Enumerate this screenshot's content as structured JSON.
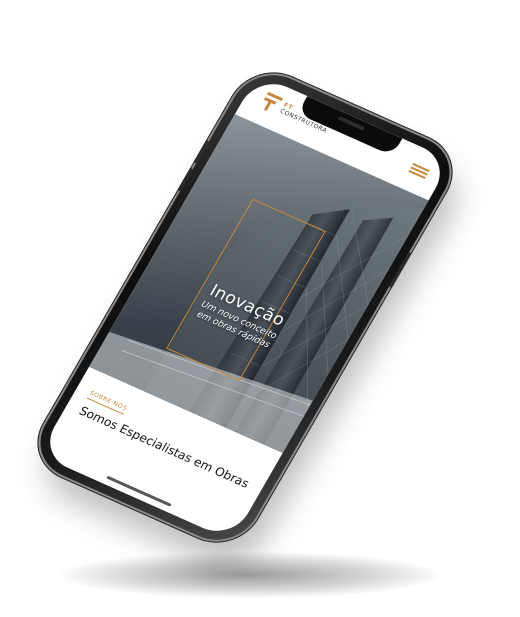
{
  "brand": {
    "logo_ft": "FT",
    "logo_name": "CONSTRUTORA",
    "accent_color": "#c8873a"
  },
  "header": {
    "menu_icon": "hamburger-menu-icon"
  },
  "hero": {
    "title": "Inovação",
    "subtitle_line1": "Um novo conceito",
    "subtitle_line2": "em obras rápidas"
  },
  "about": {
    "eyebrow": "SOBRE NÓS",
    "title": "Somos Especialistas em Obras"
  }
}
